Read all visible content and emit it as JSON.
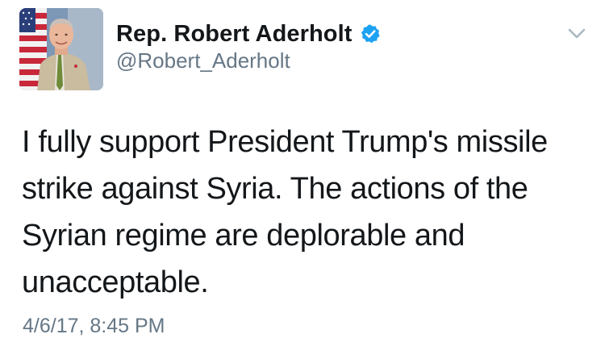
{
  "user": {
    "display_name": "Rep. Robert Aderholt",
    "handle": "@Robert_Aderholt",
    "verified": true,
    "avatar_icon": "profile-photo"
  },
  "tweet": {
    "text": "I fully support President Trump's missile strike against Syria. The actions of the Syrian regime are deplorable and unacceptable.",
    "timestamp": "4/6/17, 8:45 PM"
  },
  "icons": {
    "verified": "verified-badge-icon",
    "more": "chevron-down-icon"
  },
  "colors": {
    "verified_blue": "#1da1f2",
    "secondary_text": "#657786",
    "primary_text": "#14171a"
  }
}
